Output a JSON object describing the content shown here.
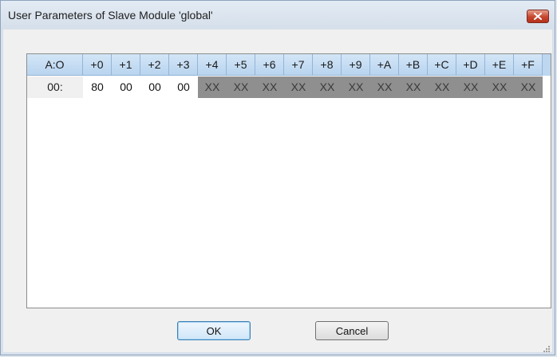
{
  "window": {
    "title": "User Parameters of Slave Module 'global'"
  },
  "grid": {
    "corner_header": "A:O",
    "column_headers": [
      "+0",
      "+1",
      "+2",
      "+3",
      "+4",
      "+5",
      "+6",
      "+7",
      "+8",
      "+9",
      "+A",
      "+B",
      "+C",
      "+D",
      "+E",
      "+F"
    ],
    "rows": [
      {
        "address": "00:",
        "values": [
          "80",
          "00",
          "00",
          "00",
          "XX",
          "XX",
          "XX",
          "XX",
          "XX",
          "XX",
          "XX",
          "XX",
          "XX",
          "XX",
          "XX",
          "XX"
        ],
        "editable_count": 4
      }
    ]
  },
  "buttons": {
    "ok_label": "OK",
    "cancel_label": "Cancel"
  },
  "colors": {
    "header_bg": "#bdd7f0",
    "disabled_cell_bg": "#8f8f8f",
    "close_button": "#c6452d"
  }
}
